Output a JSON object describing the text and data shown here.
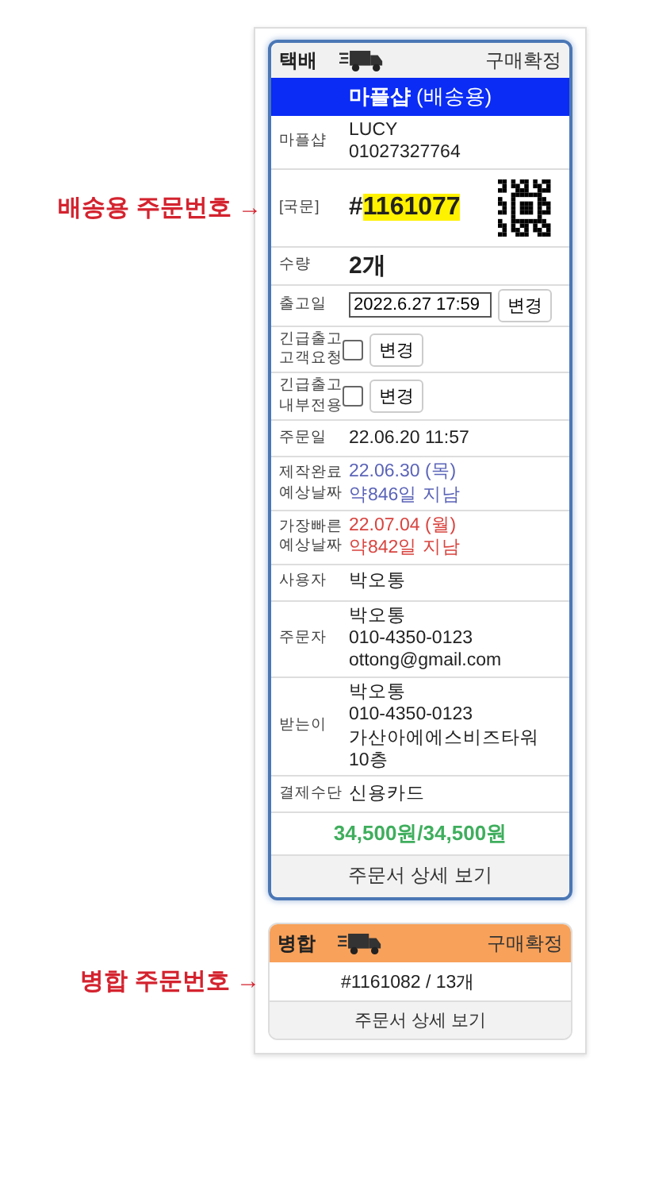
{
  "order_card": {
    "header": {
      "type": "택배",
      "status": "구매확정"
    },
    "title": {
      "name": "마플샵",
      "sub": "(배송용)"
    },
    "rows": [
      {
        "kind": "lines",
        "label": [
          "마플샵"
        ],
        "lines": [
          "LUCY",
          "01027327764"
        ]
      },
      {
        "kind": "order_no",
        "label": [
          "[국문]"
        ],
        "prefix": "#",
        "number": "1161077",
        "annotation": "배송용 주문번호",
        "arrow": "→"
      },
      {
        "kind": "qty",
        "label": [
          "수량"
        ],
        "value": "2개"
      },
      {
        "kind": "date_input",
        "label": [
          "출고일"
        ],
        "value": "2022.6.27 17:59",
        "button": "변경"
      },
      {
        "kind": "urgent",
        "label": [
          "긴급출고",
          "고객요청"
        ],
        "checked": false,
        "button": "변경"
      },
      {
        "kind": "urgent",
        "label": [
          "긴급출고",
          "내부전용"
        ],
        "checked": false,
        "button": "변경"
      },
      {
        "kind": "lines",
        "label": [
          "주문일"
        ],
        "lines": [
          "22.06.20 11:57"
        ]
      },
      {
        "kind": "estimate",
        "label": [
          "제작완료",
          "예상날짜"
        ],
        "lines": [
          "22.06.30 (목)",
          "약846일 지남"
        ],
        "color": "#5b64b8"
      },
      {
        "kind": "estimate",
        "label": [
          "가장빠른",
          "예상날짜"
        ],
        "lines": [
          "22.07.04 (월)",
          "약842일 지남"
        ],
        "color": "#d9443f"
      },
      {
        "kind": "lines",
        "label": [
          "사용자"
        ],
        "lines": [
          "박오통"
        ]
      },
      {
        "kind": "lines",
        "label": [
          "주문자"
        ],
        "lines": [
          "박오통",
          "010-4350-0123",
          "ottong@gmail.com"
        ]
      },
      {
        "kind": "lines",
        "label": [
          "받는이"
        ],
        "lines": [
          "박오통",
          "010-4350-0123",
          "가산아에에스비즈타워",
          "10층"
        ]
      },
      {
        "kind": "lines",
        "label": [
          "결제수단"
        ],
        "lines": [
          "신용카드"
        ]
      },
      {
        "kind": "total",
        "value": "34,500원/34,500원"
      }
    ],
    "detail_button": "주문서 상세 보기"
  },
  "merged_card": {
    "header": {
      "type": "병합",
      "status": "구매확정"
    },
    "order": "#1161082 / 13개",
    "annotation": "병합 주문번호",
    "arrow": "→",
    "detail_button": "주문서 상세 보기"
  }
}
